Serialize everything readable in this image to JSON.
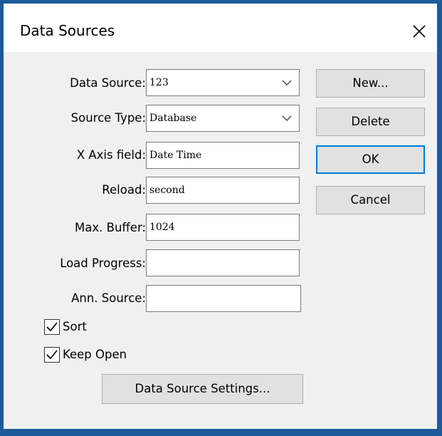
{
  "window": {
    "title": "Data Sources",
    "close_icon": "close-icon"
  },
  "form": {
    "data_source": {
      "label": "Data Source:",
      "value": "123"
    },
    "source_type": {
      "label": "Source Type:",
      "value": "Database"
    },
    "x_axis_field": {
      "label": "X Axis field:",
      "value": "Date Time"
    },
    "reload": {
      "label": "Reload:",
      "value": "second"
    },
    "max_buffer": {
      "label": "Max. Buffer:",
      "value": "1024"
    },
    "load_progress": {
      "label": "Load Progress:",
      "value": ""
    },
    "ann_source": {
      "label": "Ann. Source:",
      "value": ""
    }
  },
  "checkboxes": {
    "sort": {
      "label": "Sort",
      "checked": true
    },
    "keep_open": {
      "label": "Keep Open",
      "checked": true
    }
  },
  "buttons": {
    "new": "New...",
    "delete": "Delete",
    "ok": "OK",
    "cancel": "Cancel",
    "data_source_settings": "Data Source Settings..."
  },
  "colors": {
    "frame": "#1d5a9a",
    "accent": "#0078d7",
    "dialog_bg": "#f0f0f0"
  }
}
